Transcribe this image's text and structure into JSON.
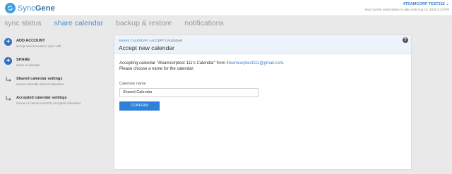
{
  "app": {
    "logo_text_light": "Sync",
    "logo_text_bold": "Gene",
    "account_name": "4TEAMCORP TEST222 ⌄",
    "subscription_note": "Your current subscription is valid until Aug 16, 2018 3:32 PM"
  },
  "tabs": [
    {
      "label": "sync status",
      "active": false
    },
    {
      "label": "share calendar",
      "active": true
    },
    {
      "label": "backup & restore",
      "active": false
    },
    {
      "label": "notifications",
      "active": false
    }
  ],
  "sidebar": {
    "items": [
      {
        "title": "ADD ACCOUNT",
        "desc": "set up new account to sync with",
        "icon": "plus-icon"
      },
      {
        "title": "SHARE",
        "desc": "share a calendar",
        "icon": "plus-icon"
      },
      {
        "title": "Shared calendar settings",
        "desc": "review currently shared calendars",
        "icon": "return-arrow-icon"
      },
      {
        "title": "Accepted calendar settings",
        "desc": "review or cancel currently accepted calendars",
        "icon": "return-arrow-icon"
      }
    ]
  },
  "panel": {
    "breadcrumb_link": "SHARE CALENDAR",
    "breadcrumb_sep": " > ",
    "breadcrumb_current": "ACCEPT CALENDAR",
    "title": "Accept new calendar",
    "help_glyph": "?",
    "accepting_prefix": "Accepting calendar \"4teamcorptest 111's Calendar\" from ",
    "accepting_email": "4teamcorptest111@gmail.com",
    "accepting_suffix": ".",
    "choose_text": "Please choose a name for the calendar:",
    "field_label": "Calendar name",
    "field_value": "Shared Calendar",
    "confirm_label": "CONFIRM"
  },
  "colors": {
    "accent": "#2f80d8",
    "tab_active": "#4a8fd6",
    "panel_header": "#edf3fa"
  }
}
